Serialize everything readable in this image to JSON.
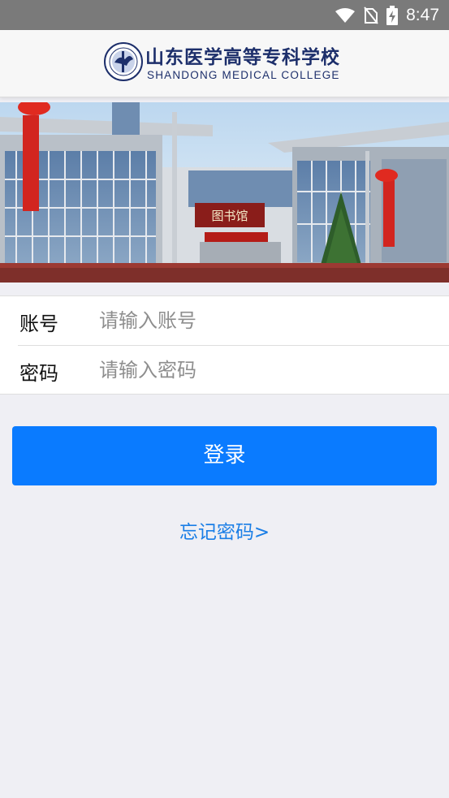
{
  "status_bar": {
    "time": "8:47",
    "icons": [
      "wifi-icon",
      "no-sim-icon",
      "battery-charging-icon"
    ]
  },
  "header": {
    "logo_cn": "山东医学高等专科学校",
    "logo_en": "SHANDONG MEDICAL COLLEGE"
  },
  "banner": {
    "sign_text": "图书馆"
  },
  "form": {
    "account_label": "账号",
    "account_placeholder": "请输入账号",
    "password_label": "密码",
    "password_placeholder": "请输入密码"
  },
  "actions": {
    "login_label": "登录",
    "forgot_label": "忘记密码>"
  },
  "colors": {
    "accent": "#0a7bff",
    "link": "#1a7ee6",
    "background": "#efeff4",
    "brand_navy": "#1d2f6b"
  }
}
